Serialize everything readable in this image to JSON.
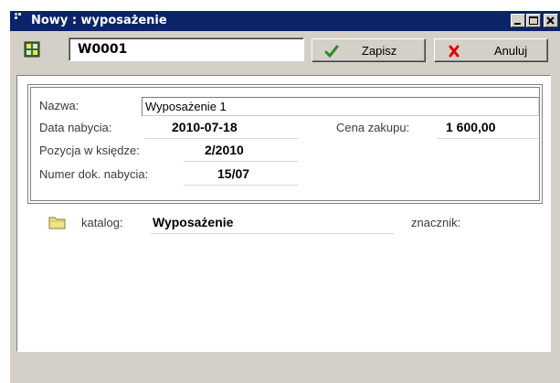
{
  "window": {
    "title": "Nowy : wyposażenie",
    "colors": {
      "titlebar": "#0a246a",
      "face": "#d4d0c8",
      "accept": "#2e8b1e",
      "cancel": "#e00000"
    }
  },
  "toolbar": {
    "code_value": "W0001",
    "save_label": "Zapisz",
    "cancel_label": "Anuluj"
  },
  "form": {
    "name_label": "Nazwa:",
    "name_value": "Wyposażenie 1",
    "date_label": "Data nabycia:",
    "date_value": "2010-07-18",
    "price_label": "Cena zakupu:",
    "price_value": "1 600,00",
    "ledger_label": "Pozycja w księdze:",
    "ledger_value": "2/2010",
    "doc_label": "Numer dok. nabycia:",
    "doc_value": "15/07"
  },
  "catalog": {
    "label": "katalog:",
    "value": "Wyposażenie",
    "marker_label": "znacznik:",
    "marker_value": ""
  },
  "icons": [
    "app-icon",
    "minimize-icon",
    "maximize-icon",
    "close-icon",
    "record-icon",
    "checkmark-icon",
    "cross-icon",
    "folder-icon"
  ]
}
